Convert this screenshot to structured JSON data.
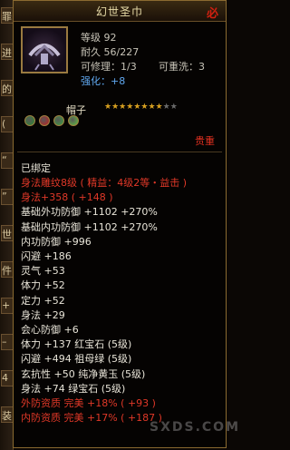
{
  "title": "幻世圣巾",
  "left_strip": [
    "罪",
    "进",
    "的",
    "(",
    "“",
    "”",
    "世",
    "件",
    "+",
    "–",
    "4",
    "装"
  ],
  "header": {
    "level": "等级 92",
    "durability": "耐久 56/227",
    "repairable": "可修理：1/3",
    "rewashable": "可重洗：3",
    "strengthen_label": "强化：",
    "strengthen_value": "+8"
  },
  "item_type": "帽子",
  "stars": {
    "filled": 8,
    "total": 10
  },
  "gems": [
    "#2a8a30",
    "#c02020",
    "#3aa040",
    "#60c040"
  ],
  "tag": "贵重",
  "bound": "已绑定",
  "lines": [
    {
      "text": "身法雕纹8级 ( 精益：4级2等・益击 )",
      "color": "r"
    },
    {
      "text": "身法+358 ( +148 )",
      "color": "r"
    },
    {
      "text": "基础外功防御 +1102 +270%",
      "color": "w"
    },
    {
      "text": "基础内功防御 +1102 +270%",
      "color": "w"
    },
    {
      "text": "内功防御 +996",
      "color": "w"
    },
    {
      "text": "闪避 +186",
      "color": "w"
    },
    {
      "text": "灵气 +53",
      "color": "w"
    },
    {
      "text": "体力 +52",
      "color": "w"
    },
    {
      "text": "定力 +52",
      "color": "w"
    },
    {
      "text": "身法 +29",
      "color": "w"
    },
    {
      "text": "会心防御 +6",
      "color": "w"
    },
    {
      "text": "体力 +137 红宝石 (5级)",
      "color": "w"
    },
    {
      "text": "闪避 +494 祖母绿 (5级)",
      "color": "w"
    },
    {
      "text": "玄抗性 +50 纯净黄玉 (5级)",
      "color": "w"
    },
    {
      "text": "身法 +74 绿宝石 (5级)",
      "color": "w"
    },
    {
      "text": "外防资质  完美 +18% ( +93 )",
      "color": "r"
    },
    {
      "text": "内防资质  完美 +17% ( +187 )",
      "color": "r"
    }
  ],
  "watermark": "SXDS.COM"
}
